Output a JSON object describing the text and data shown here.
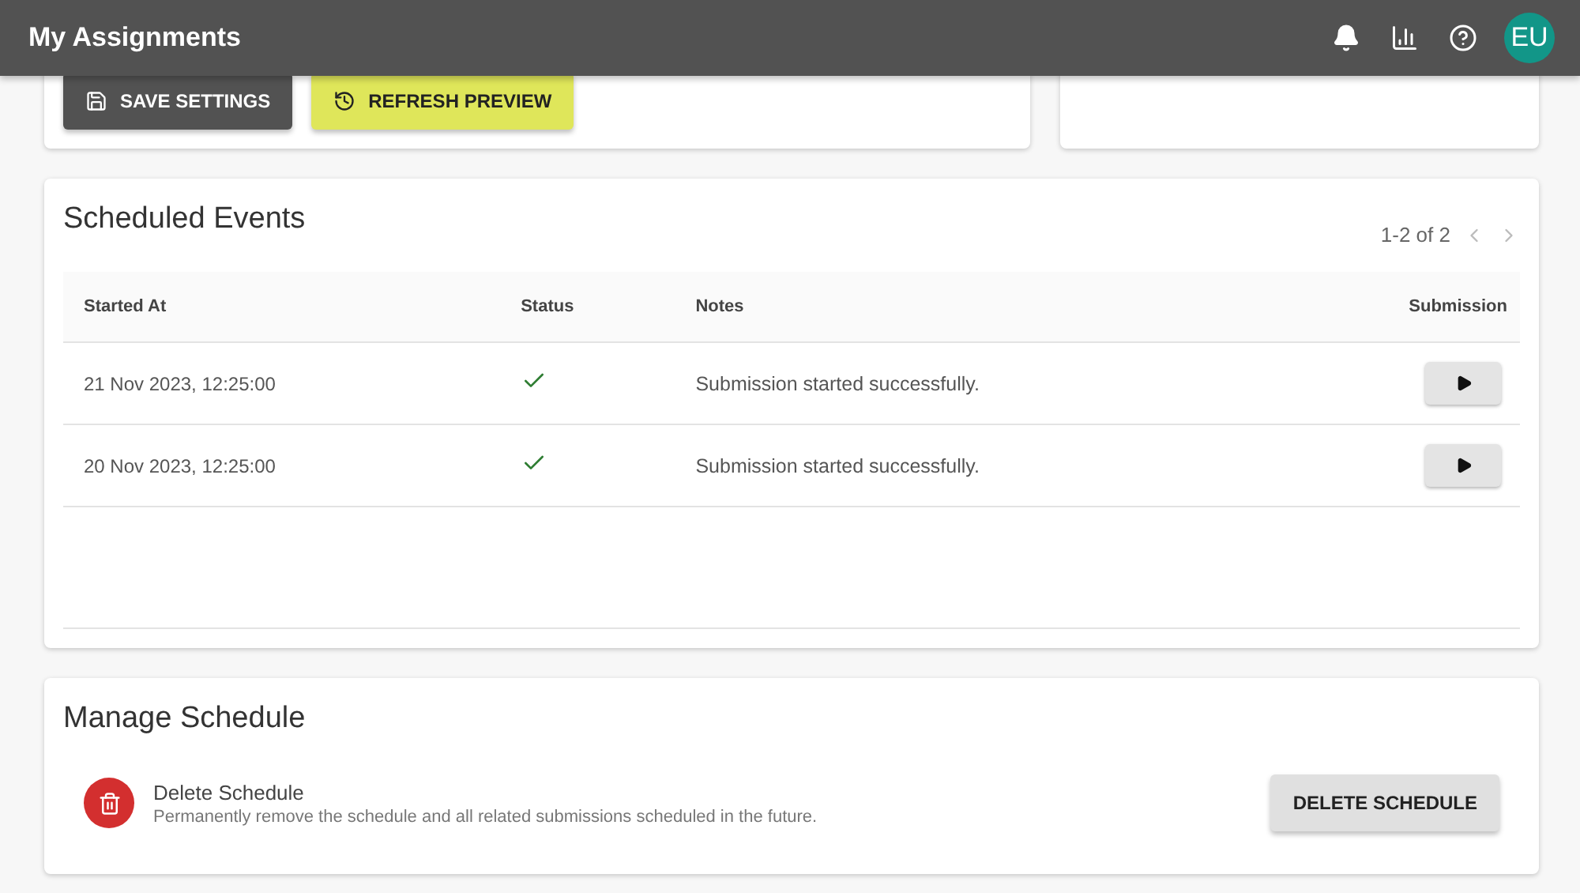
{
  "app_bar": {
    "title": "My Assignments",
    "avatar": "EU"
  },
  "settings_card": {
    "buttons": [
      {
        "label": "SAVE SETTINGS",
        "kind": "save"
      },
      {
        "label": "REFRESH PREVIEW",
        "kind": "refresh"
      }
    ]
  },
  "scheduled_events": {
    "title": "Scheduled Events",
    "pagination": "1-2 of 2",
    "columns": [
      "Started At",
      "Status",
      "Notes",
      "Submission"
    ],
    "rows": [
      {
        "started_at": "21 Nov 2023, 12:25:00",
        "succeeded": true,
        "notes": "Submission started successfully."
      },
      {
        "started_at": "20 Nov 2023, 12:25:00",
        "succeeded": true,
        "notes": "Submission started successfully."
      }
    ]
  },
  "manage_schedule": {
    "title": "Manage Schedule",
    "action_title": "Delete Schedule",
    "action_description": "Permanently remove the schedule and all related submissions scheduled in the future.",
    "button": "DELETE SCHEDULE"
  }
}
